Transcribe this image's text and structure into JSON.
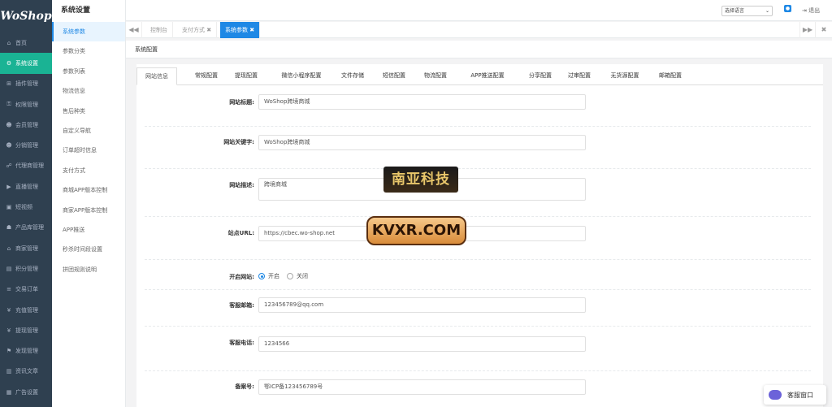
{
  "logo": "WoShop",
  "nav": [
    {
      "icon": "⌂",
      "label": "首页"
    },
    {
      "icon": "⚙",
      "label": "系统设置",
      "active": true
    },
    {
      "icon": "⊞",
      "label": "插件管理"
    },
    {
      "icon": "⚿",
      "label": "权限管理"
    },
    {
      "icon": "☻",
      "label": "会员管理"
    },
    {
      "icon": "☻",
      "label": "分销管理"
    },
    {
      "icon": "☍",
      "label": "代理商管理"
    },
    {
      "icon": "▶",
      "label": "直播管理"
    },
    {
      "icon": "▣",
      "label": "短视频"
    },
    {
      "icon": "☗",
      "label": "产品库管理"
    },
    {
      "icon": "⌂",
      "label": "商家管理"
    },
    {
      "icon": "▤",
      "label": "积分管理"
    },
    {
      "icon": "≡",
      "label": "交易订单"
    },
    {
      "icon": "¥",
      "label": "充值管理"
    },
    {
      "icon": "¥",
      "label": "提现管理"
    },
    {
      "icon": "⚑",
      "label": "发现管理"
    },
    {
      "icon": "▥",
      "label": "资讯文章"
    },
    {
      "icon": "▦",
      "label": "广告设置"
    }
  ],
  "sub": {
    "title": "系统设置",
    "items": [
      {
        "label": "系统参数",
        "active": true
      },
      {
        "label": "参数分类"
      },
      {
        "label": "参数列表"
      },
      {
        "label": "物流信息"
      },
      {
        "label": "售后种类"
      },
      {
        "label": "自定义导航"
      },
      {
        "label": "订单超时信息"
      },
      {
        "label": "支付方式"
      },
      {
        "label": "商城APP版本控制"
      },
      {
        "label": "商家APP版本控制"
      },
      {
        "label": "APP推送"
      },
      {
        "label": "秒杀时间段设置"
      },
      {
        "label": "拼团规则说明"
      }
    ]
  },
  "topbar": {
    "lang": "选择语言",
    "logout": "退出"
  },
  "tabs": {
    "back": "◀◀",
    "forward": "▶▶",
    "close_all": "✖",
    "items": [
      {
        "label": "控制台"
      },
      {
        "label": "支付方式 ✖"
      },
      {
        "label": "系统参数 ✖",
        "active": true
      }
    ]
  },
  "panel_title": "系统配置",
  "cfg_tabs": [
    "网站信息",
    "常规配置",
    "提现配置",
    "微信小程序配置",
    "文件存储",
    "短信配置",
    "物流配置",
    "APP推送配置",
    "分享配置",
    "过审配置",
    "无货源配置",
    "邮箱配置"
  ],
  "form": {
    "site_title": {
      "label": "网站标题:",
      "value": "WoShop跨境商城"
    },
    "keywords": {
      "label": "网站关键字:",
      "value": "WoShop跨境商城"
    },
    "description": {
      "label": "网站描述:",
      "value": "跨境商城"
    },
    "url": {
      "label": "站点URL:",
      "value": "https://cbec.wo-shop.net"
    },
    "open_site": {
      "label": "开启网站:",
      "on": "开启",
      "off": "关闭"
    },
    "email": {
      "label": "客服邮箱:",
      "value": "123456789@qq.com"
    },
    "phone": {
      "label": "客服电话:",
      "value": "1234566"
    },
    "icp": {
      "label": "备案号:",
      "value": "鄂ICP备123456789号"
    }
  },
  "watermark1": "南亚科技",
  "watermark2": "KVXR.COM",
  "chat": "客服窗口"
}
